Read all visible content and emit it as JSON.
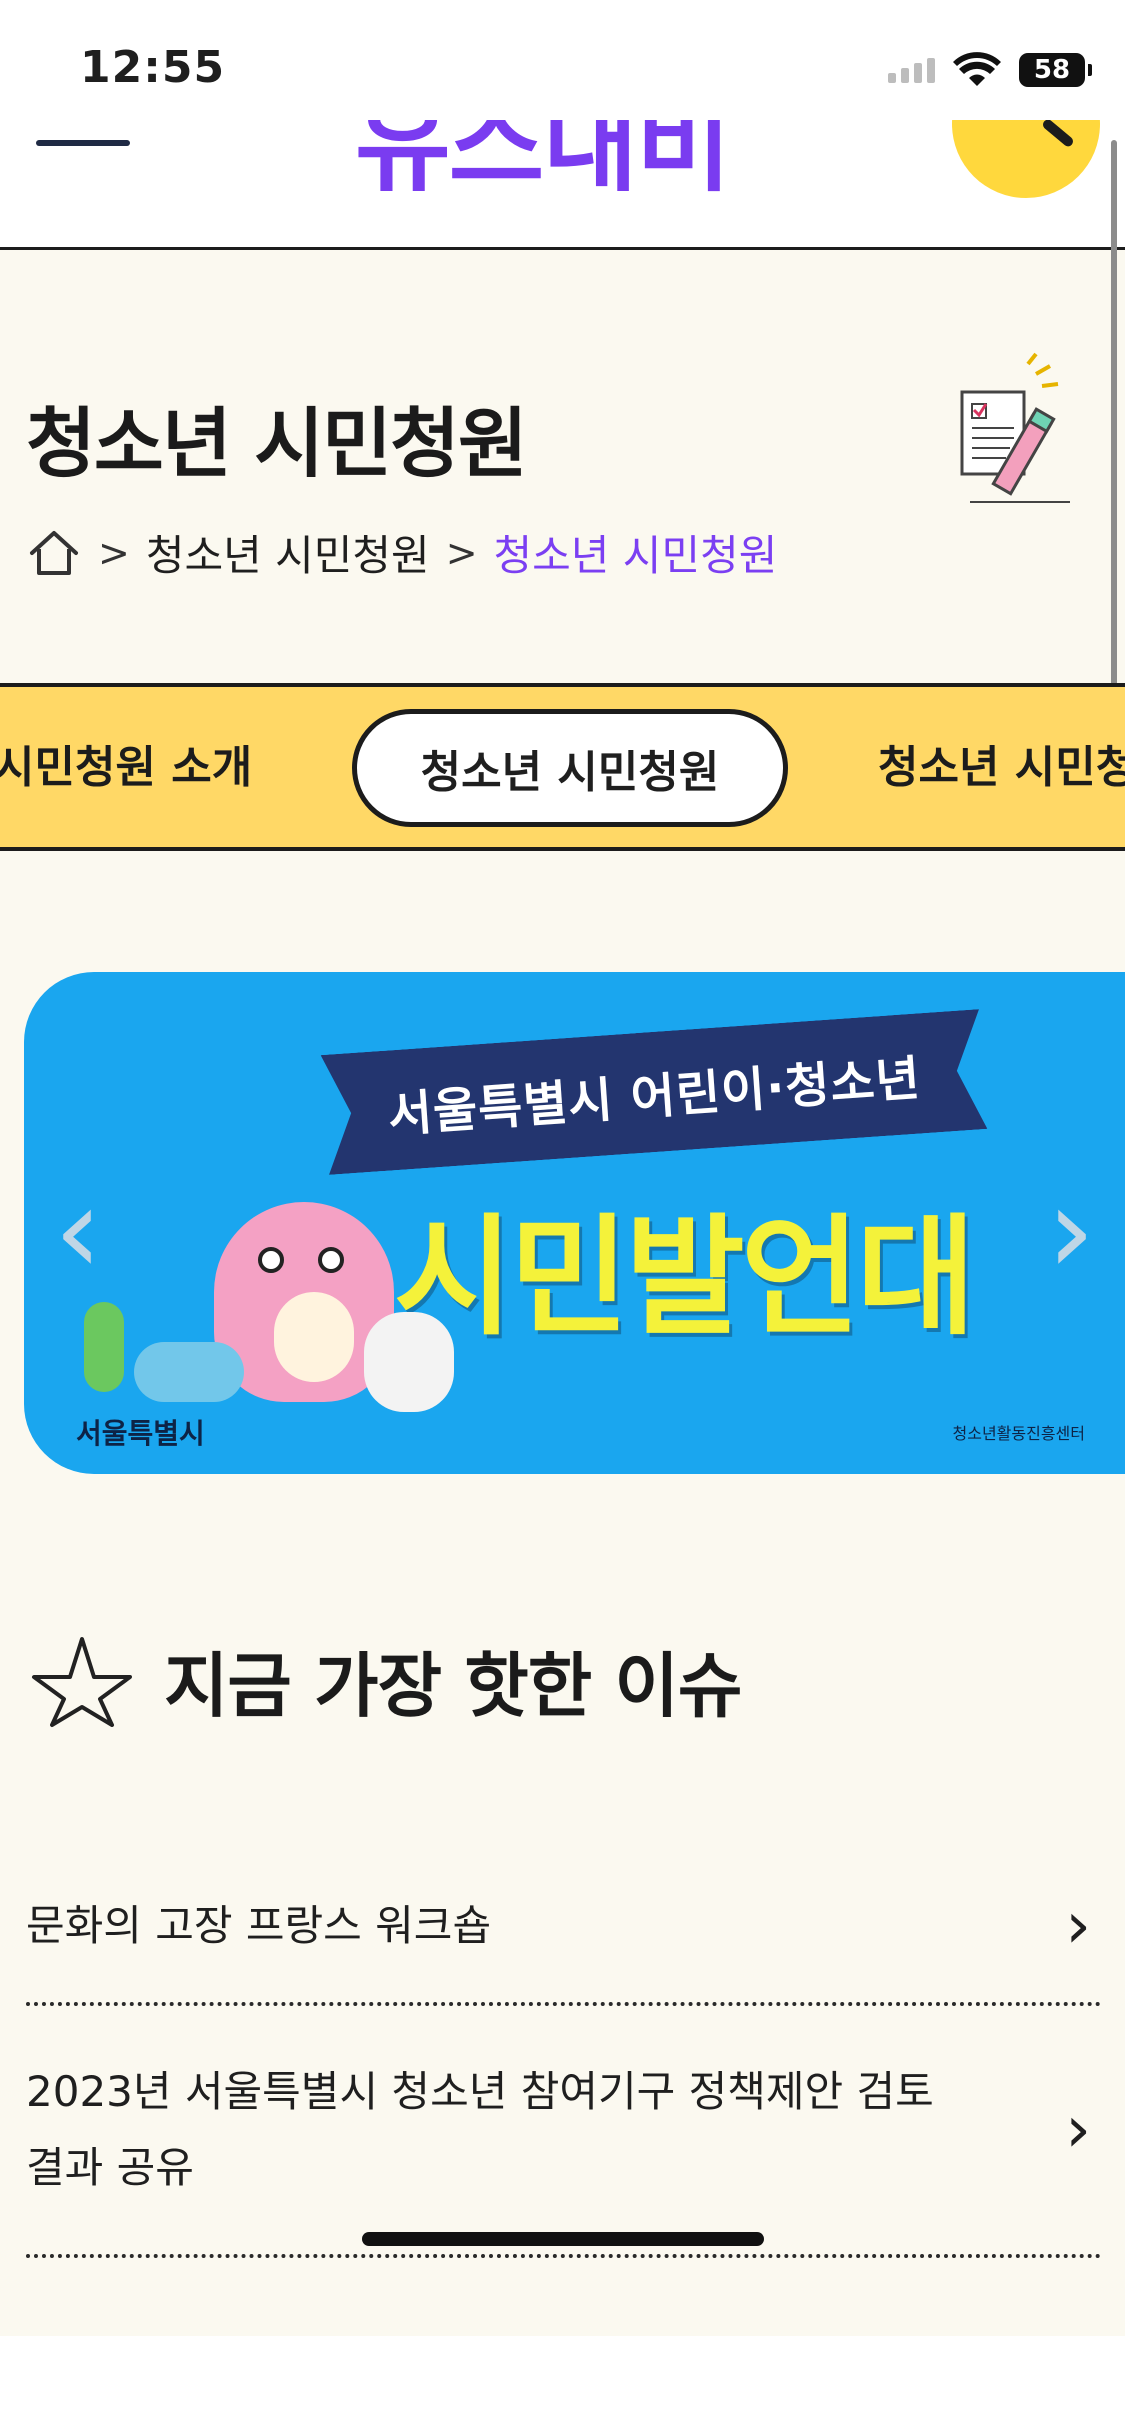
{
  "status_bar": {
    "time": "12:55",
    "battery": "58"
  },
  "header": {
    "logo_text": "유스내비"
  },
  "page_header": {
    "title": "청소년 시민청원",
    "breadcrumb": [
      "청소년 시민청원",
      "청소년 시민청원"
    ],
    "breadcrumb_sep": ">"
  },
  "tabs": {
    "items": [
      "시민청원 소개",
      "청소년 시민청원",
      "청소년 시민청원"
    ],
    "active": "청소년 시민청원"
  },
  "banner": {
    "ribbon": "서울특별시 어린이·청소년",
    "title": "시민발언대",
    "left_logo": "서울특별시",
    "right_logo": "청소년활동진흥센터"
  },
  "hot_issues": {
    "title": "지금 가장 핫한 이슈",
    "items": [
      "문화의 고장 프랑스 워크숍",
      "2023년 서울특별시 청소년 참여기구 정책제안 검토 결과 공유"
    ]
  }
}
